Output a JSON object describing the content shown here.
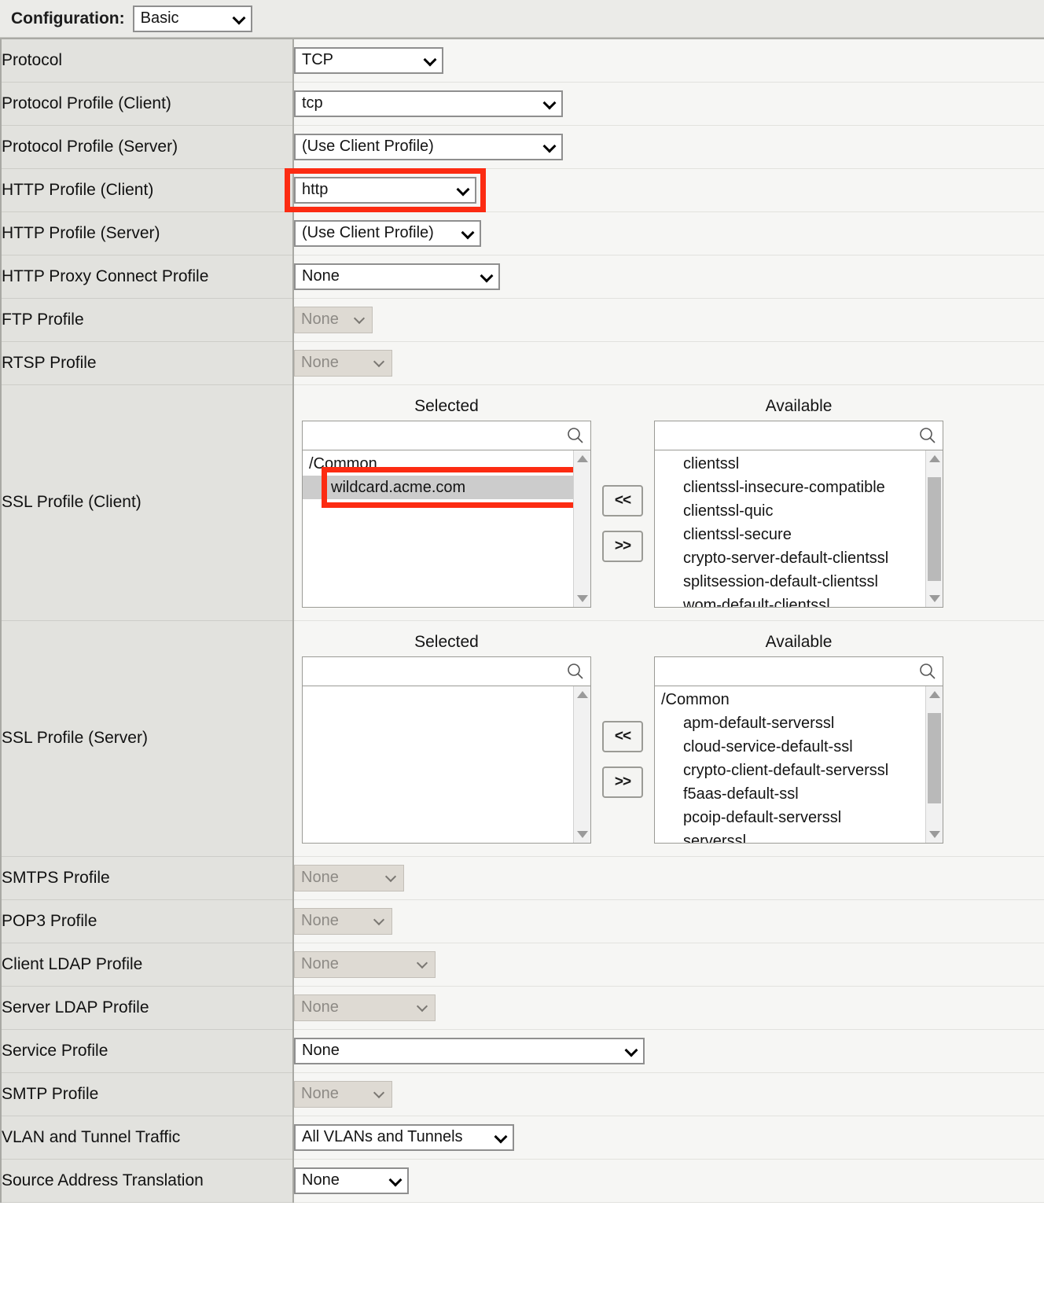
{
  "header": {
    "label": "Configuration:",
    "value": "Basic"
  },
  "rows": {
    "protocol": {
      "label": "Protocol",
      "value": "TCP"
    },
    "protocol_profile_client": {
      "label": "Protocol Profile (Client)",
      "value": "tcp"
    },
    "protocol_profile_server": {
      "label": "Protocol Profile (Server)",
      "value": "(Use Client Profile)"
    },
    "http_profile_client": {
      "label": "HTTP Profile (Client)",
      "value": "http"
    },
    "http_profile_server": {
      "label": "HTTP Profile (Server)",
      "value": "(Use Client Profile)"
    },
    "http_proxy_connect_profile": {
      "label": "HTTP Proxy Connect Profile",
      "value": "None"
    },
    "ftp_profile": {
      "label": "FTP Profile",
      "value": "None"
    },
    "rtsp_profile": {
      "label": "RTSP Profile",
      "value": "None"
    },
    "ssl_profile_client": {
      "label": "SSL Profile (Client)"
    },
    "ssl_profile_server": {
      "label": "SSL Profile (Server)"
    },
    "smtps_profile": {
      "label": "SMTPS Profile",
      "value": "None"
    },
    "pop3_profile": {
      "label": "POP3 Profile",
      "value": "None"
    },
    "client_ldap_profile": {
      "label": "Client LDAP Profile",
      "value": "None"
    },
    "server_ldap_profile": {
      "label": "Server LDAP Profile",
      "value": "None"
    },
    "service_profile": {
      "label": "Service Profile",
      "value": "None"
    },
    "smtp_profile": {
      "label": "SMTP Profile",
      "value": "None"
    },
    "vlan_and_tunnel_traffic": {
      "label": "VLAN and Tunnel Traffic",
      "value": "All VLANs and Tunnels"
    },
    "source_address_translation": {
      "label": "Source Address Translation",
      "value": "None"
    }
  },
  "dual_list": {
    "selected_header": "Selected",
    "available_header": "Available",
    "move_left_label": "<<",
    "move_right_label": ">>"
  },
  "ssl_client": {
    "selected": [
      {
        "text": "/Common",
        "group": true,
        "highlighted": false
      },
      {
        "text": "wildcard.acme.com",
        "group": false,
        "highlighted": true
      }
    ],
    "available": [
      {
        "text": "clientssl",
        "group": false
      },
      {
        "text": "clientssl-insecure-compatible",
        "group": false
      },
      {
        "text": "clientssl-quic",
        "group": false
      },
      {
        "text": "clientssl-secure",
        "group": false
      },
      {
        "text": "crypto-server-default-clientssl",
        "group": false
      },
      {
        "text": "splitsession-default-clientssl",
        "group": false
      },
      {
        "text": "wom-default-clientssl",
        "group": false
      }
    ]
  },
  "ssl_server": {
    "selected": [],
    "available": [
      {
        "text": "/Common",
        "group": true
      },
      {
        "text": "apm-default-serverssl",
        "group": false
      },
      {
        "text": "cloud-service-default-ssl",
        "group": false
      },
      {
        "text": "crypto-client-default-serverssl",
        "group": false
      },
      {
        "text": "f5aas-default-ssl",
        "group": false
      },
      {
        "text": "pcoip-default-serverssl",
        "group": false
      },
      {
        "text": "serverssl",
        "group": false
      }
    ]
  },
  "colors": {
    "highlight": "#fc2b12",
    "label_cell": "#e2e2de",
    "value_cell": "#f6f6f4",
    "selected_row": "#cccccc"
  }
}
